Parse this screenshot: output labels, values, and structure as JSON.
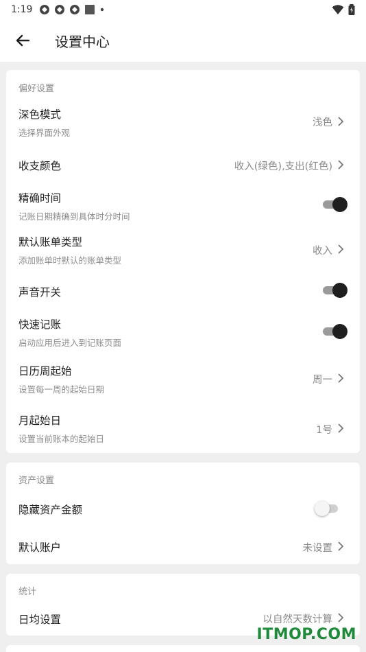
{
  "status_bar": {
    "time": "1:19"
  },
  "header": {
    "title": "设置中心"
  },
  "sections": {
    "preferences": {
      "title": "偏好设置",
      "dark_mode": {
        "label": "深色模式",
        "sub": "选择界面外观",
        "value": "浅色"
      },
      "income_expense_color": {
        "label": "收支颜色",
        "value": "收入(绿色),支出(红色)"
      },
      "precise_time": {
        "label": "精确时间",
        "sub": "记账日期精确到具体时分时间",
        "on": true
      },
      "default_bill_type": {
        "label": "默认账单类型",
        "sub": "添加账单时默认的账单类型",
        "value": "收入"
      },
      "sound": {
        "label": "声音开关",
        "on": true
      },
      "quick_bookkeeping": {
        "label": "快速记账",
        "sub": "启动应用后进入到记账页面",
        "on": true
      },
      "week_start": {
        "label": "日历周起始",
        "sub": "设置每一周的起始日期",
        "value": "周一"
      },
      "month_start": {
        "label": "月起始日",
        "sub": "设置当前账本的起始日",
        "value": "1号"
      }
    },
    "assets": {
      "title": "资产设置",
      "hide_amount": {
        "label": "隐藏资产金额",
        "on": false
      },
      "default_account": {
        "label": "默认账户",
        "value": "未设置"
      }
    },
    "stats": {
      "title": "统计",
      "daily_average": {
        "label": "日均设置",
        "value": "以自然天数计算"
      }
    }
  },
  "watermark": "ITMOP.COM"
}
